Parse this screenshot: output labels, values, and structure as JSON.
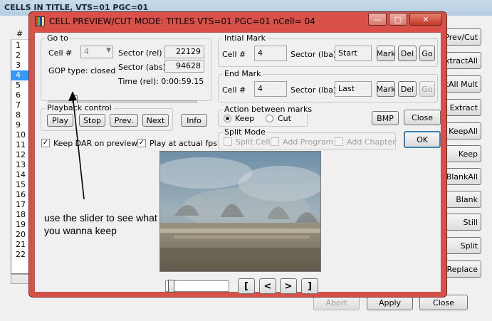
{
  "background_window": {
    "title": "CELLS IN TITLE, VTS=01 PGC=01",
    "list_header": "#",
    "list_items": [
      "1",
      "2",
      "3",
      "4",
      "5",
      "6",
      "7",
      "8",
      "9",
      "10",
      "11",
      "12",
      "13",
      "14",
      "15",
      "16",
      "17",
      "18",
      "19",
      "20",
      "21",
      "22"
    ],
    "selected_index": 3,
    "right_buttons": [
      "Prev/Cut",
      "ExtractAll",
      "ExtAll Mult",
      "Extract",
      "KeepAll",
      "Keep",
      "BlankAll",
      "Blank",
      "Still",
      "Split",
      "Replace"
    ],
    "bottom_buttons": {
      "abort": "Abort",
      "apply": "Apply",
      "close": "Close"
    }
  },
  "dialog": {
    "title": "CELL PREVIEW/CUT MODE: TITLES VTS=01 PGC=01 nCell= 04",
    "goto": {
      "group_label": "Go to",
      "cell_label": "Cell #",
      "cell_value": "4",
      "sector_rel_label": "Sector (rel)",
      "sector_rel_value": "22129",
      "sector_abs_label": "Sector (abs)",
      "sector_abs_value": "94628",
      "gop_type": "GOP type: closed",
      "time_rel": "Time (rel): 0:00:59.15",
      "slider_position": 0.17
    },
    "playback": {
      "group_label": "Playback control",
      "play": "Play",
      "stop": "Stop",
      "prev": "Prev.",
      "next": "Next"
    },
    "info_button": "Info",
    "keep_dar": {
      "label": "Keep DAR on preview",
      "checked": true
    },
    "play_actual_fps": {
      "label": "Play at actual fps",
      "checked": true
    },
    "initial_mark": {
      "group_label": "Intial Mark",
      "cell_label": "Cell #",
      "cell_value": "4",
      "sector_label": "Sector (lba)",
      "sector_value": "Start",
      "mark": "Mark",
      "del": "Del",
      "go": "Go"
    },
    "end_mark": {
      "group_label": "End Mark",
      "cell_label": "Cell #",
      "cell_value": "4",
      "sector_label": "Sector (lba)",
      "sector_value": "Last",
      "mark": "Mark",
      "del": "Del",
      "go": "Go"
    },
    "action": {
      "group_label": "Action between marks",
      "keep": "Keep",
      "cut": "Cut",
      "selected": "keep"
    },
    "bmp_button": "BMP",
    "close_button": "Close",
    "ok_button": "OK",
    "split_mode": {
      "group_label": "Split Mode",
      "split_cell": "Split Cell",
      "add_program": "Add Program",
      "add_chapter": "Add Chapter"
    },
    "nav": {
      "open_bracket": "[",
      "prev": "<",
      "next": ">",
      "close_bracket": "]",
      "seek_position": 0.04
    },
    "annotation": "use the slider to see what you wanna keep"
  },
  "colors": {
    "dialog_frame": "#d85048",
    "selection": "#3399ff",
    "window_bg": "#f0f0f0"
  }
}
